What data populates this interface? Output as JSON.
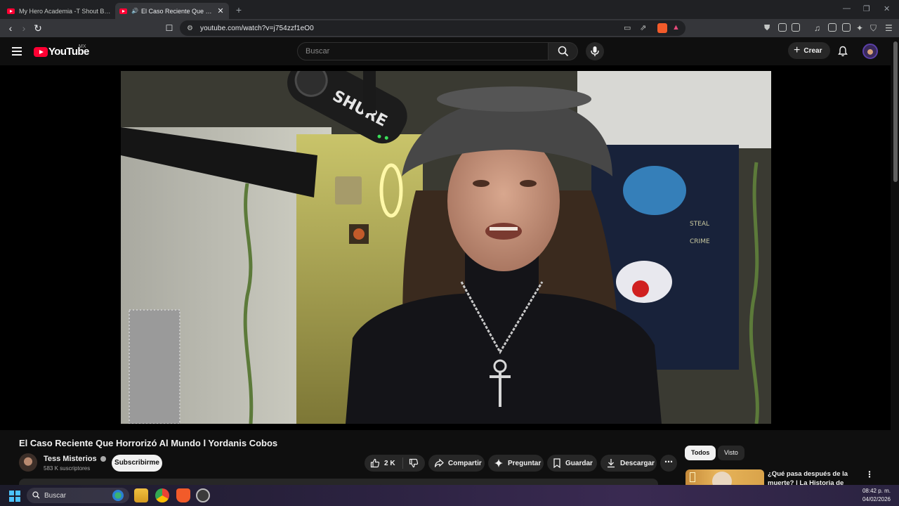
{
  "browser": {
    "tabs": [
      {
        "title": "My Hero Academia -T Shout Baby 是",
        "active": false
      },
      {
        "title": "El Caso Reciente Que Horroriz",
        "active": true
      }
    ],
    "url": "youtube.com/watch?v=j754zzf1eO0"
  },
  "header": {
    "logo_text": "YouTube",
    "region": "MX",
    "search_placeholder": "Buscar",
    "create_label": "Crear"
  },
  "video": {
    "title": "El Caso Reciente Que Horrorizó Al Mundo l Yordanis Cobos",
    "mic_brand": "SHURE"
  },
  "channel": {
    "name": "Tess Misterios",
    "subscribers": "583 K suscriptores",
    "subscribe_label": "Subscribirme"
  },
  "actions": {
    "likes": "2 K",
    "share": "Compartir",
    "ask": "Preguntar",
    "save": "Guardar",
    "download": "Descargar",
    "more": "⋯"
  },
  "sidebar": {
    "chips": [
      "Todos",
      "Visto"
    ],
    "recommendation": {
      "title": "¿Qué pasa después de la muerte? | La Historia de Dios"
    }
  },
  "taskbar": {
    "search_label": "Buscar",
    "time": "08:42 p. m.",
    "date": "04/02/2026"
  },
  "colors": {
    "accent": "#ff0033",
    "background": "#0f0f0f",
    "chip_active": "#f1f1f1"
  }
}
